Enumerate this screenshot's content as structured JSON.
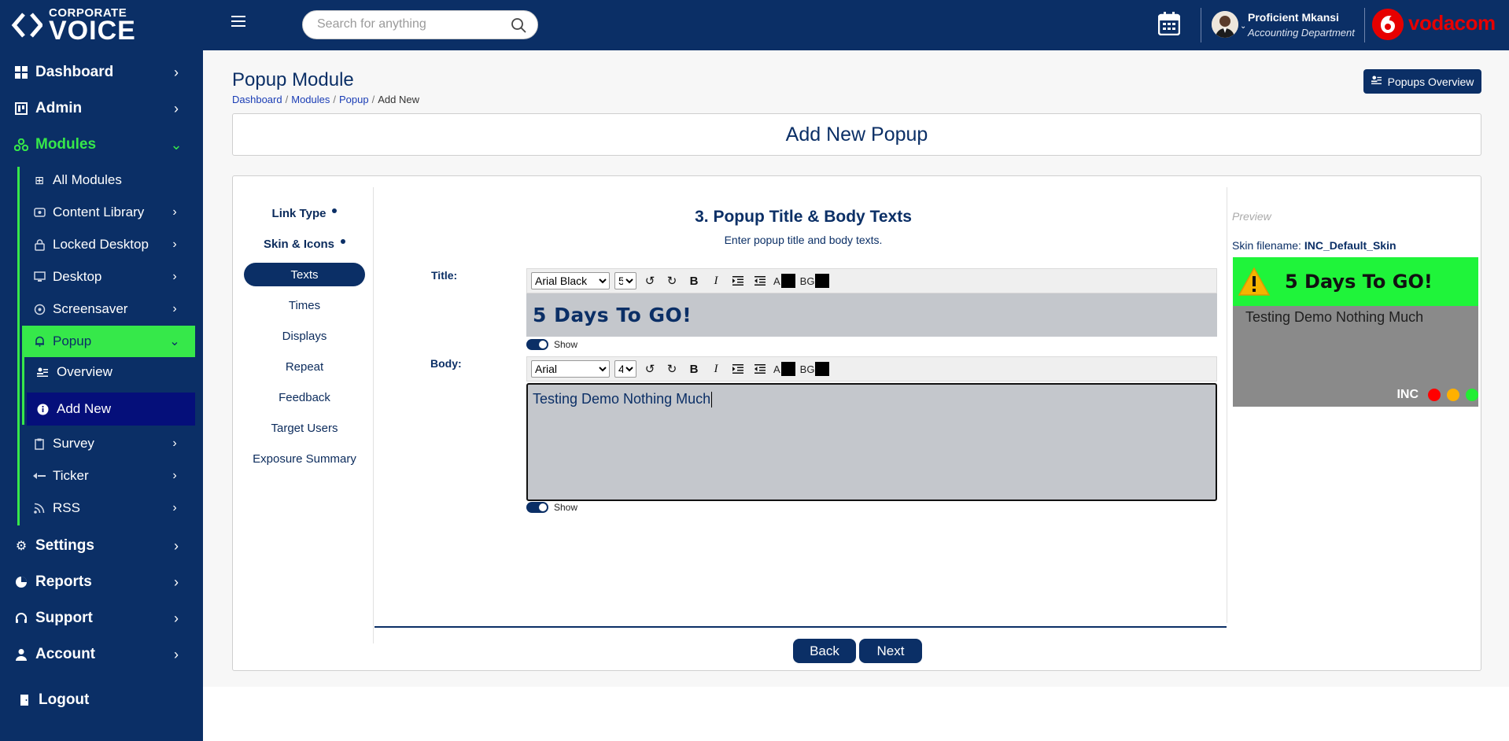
{
  "brand": {
    "line1": "CORPORATE",
    "line2": "VOICE"
  },
  "sidebar": {
    "items": [
      {
        "label": "Dashboard",
        "icon": "grid-icon"
      },
      {
        "label": "Admin",
        "icon": "admin-icon"
      },
      {
        "label": "Modules",
        "icon": "modules-icon"
      },
      {
        "label": "Settings",
        "icon": "gear-icon"
      },
      {
        "label": "Reports",
        "icon": "pie-chart-icon"
      },
      {
        "label": "Support",
        "icon": "headset-icon"
      },
      {
        "label": "Account",
        "icon": "user-icon"
      },
      {
        "label": "Logout",
        "icon": "door-icon"
      }
    ],
    "modules_sub": [
      {
        "label": "All Modules"
      },
      {
        "label": "Content Library"
      },
      {
        "label": "Locked Desktop"
      },
      {
        "label": "Desktop"
      },
      {
        "label": "Screensaver"
      },
      {
        "label": "Popup"
      },
      {
        "label": "Survey"
      },
      {
        "label": "Ticker"
      },
      {
        "label": "RSS"
      }
    ],
    "popup_sub": [
      {
        "label": "Overview"
      },
      {
        "label": "Add New"
      }
    ]
  },
  "topbar": {
    "search_placeholder": "Search for anything",
    "user_name": "Proficient Mkansi",
    "user_dept": "Accounting Department",
    "partner": "vodacom"
  },
  "page": {
    "title": "Popup Module",
    "breadcrumb": [
      "Dashboard",
      "Modules",
      "Popup",
      "Add New"
    ],
    "overview_button": "Popups Overview",
    "card_title": "Add New Popup"
  },
  "steps": [
    "Link Type",
    "Skin & Icons",
    "Texts",
    "Times",
    "Displays",
    "Repeat",
    "Feedback",
    "Target Users",
    "Exposure Summary"
  ],
  "form": {
    "section_title": "3. Popup Title & Body Texts",
    "section_sub": "Enter popup title and body texts.",
    "title_label": "Title:",
    "body_label": "Body:",
    "title_font": "Arial Black",
    "title_size": "5",
    "body_font": "Arial",
    "body_size": "4",
    "text_color_label": "A",
    "bg_color_label": "BG",
    "title_text": "5 Days To GO!",
    "body_text": "Testing Demo Nothing Much",
    "show_label": "Show",
    "font_options": [
      "Arial Black",
      "Arial"
    ],
    "size_options": [
      "5",
      "4"
    ]
  },
  "preview": {
    "label": "Preview",
    "skin_prefix": "Skin filename:",
    "skin_name": "INC_Default_Skin",
    "title": "5 Days To GO!",
    "body": "Testing Demo Nothing Much",
    "inc": "INC",
    "head_color": "#1ff43a",
    "dots": [
      "#ff0000",
      "#ffb000",
      "#22ee33"
    ]
  },
  "buttons": {
    "back": "Back",
    "next": "Next"
  },
  "colors": {
    "navy": "#0b2f66",
    "accent_green": "#36e84a",
    "active_sub": "#050f7a",
    "vodafone_red": "#e60000"
  }
}
